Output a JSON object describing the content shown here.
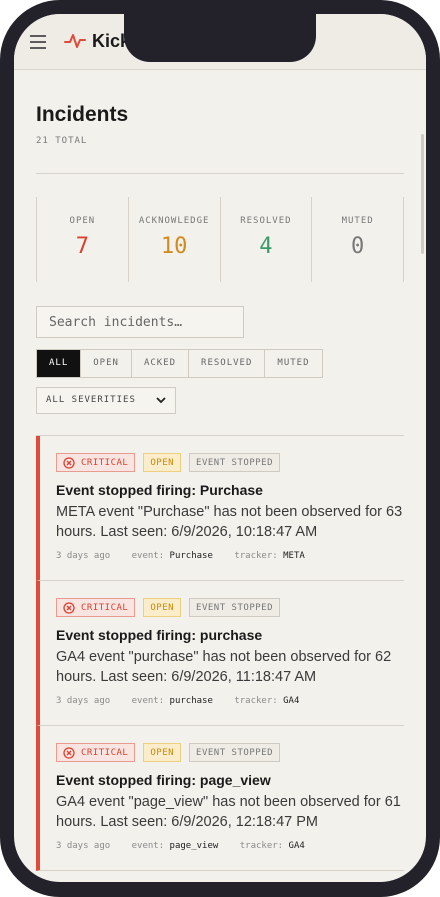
{
  "header": {
    "brand": "Kickb",
    "menu_icon": "hamburger-icon",
    "logo_icon": "pulse-icon",
    "accent": "#e04a3a"
  },
  "page": {
    "title": "Incidents",
    "total": "21 TOTAL"
  },
  "stats": [
    {
      "label": "OPEN",
      "value": "7",
      "color": "#d9412f"
    },
    {
      "label": "ACKNOWLEDGE",
      "value": "10",
      "color": "#d08a1e"
    },
    {
      "label": "RESOLVED",
      "value": "4",
      "color": "#3a9a6a"
    },
    {
      "label": "MUTED",
      "value": "0",
      "color": "#777777"
    }
  ],
  "search": {
    "placeholder": "Search incidents…"
  },
  "filters": [
    "ALL",
    "OPEN",
    "ACKED",
    "RESOLVED",
    "MUTED"
  ],
  "active_filter": "ALL",
  "severity_select": {
    "value": "ALL SEVERITIES"
  },
  "incidents": [
    {
      "severity": "CRITICAL",
      "status": "OPEN",
      "type": "EVENT STOPPED",
      "title": "Event stopped firing: Purchase",
      "description": "META event \"Purchase\" has not been observed for 63 hours. Last seen: 6/9/2026, 10:18:47 AM",
      "age": "3 days ago",
      "event_label": "event:",
      "event": "Purchase",
      "tracker_label": "tracker:",
      "tracker": "META"
    },
    {
      "severity": "CRITICAL",
      "status": "OPEN",
      "type": "EVENT STOPPED",
      "title": "Event stopped firing: purchase",
      "description": "GA4 event \"purchase\" has not been observed for 62 hours. Last seen: 6/9/2026, 11:18:47 AM",
      "age": "3 days ago",
      "event_label": "event:",
      "event": "purchase",
      "tracker_label": "tracker:",
      "tracker": "GA4"
    },
    {
      "severity": "CRITICAL",
      "status": "OPEN",
      "type": "EVENT STOPPED",
      "title": "Event stopped firing: page_view",
      "description": "GA4 event \"page_view\" has not been observed for 61 hours. Last seen: 6/9/2026, 12:18:47 PM",
      "age": "3 days ago",
      "event_label": "event:",
      "event": "page_view",
      "tracker_label": "tracker:",
      "tracker": "GA4"
    }
  ]
}
